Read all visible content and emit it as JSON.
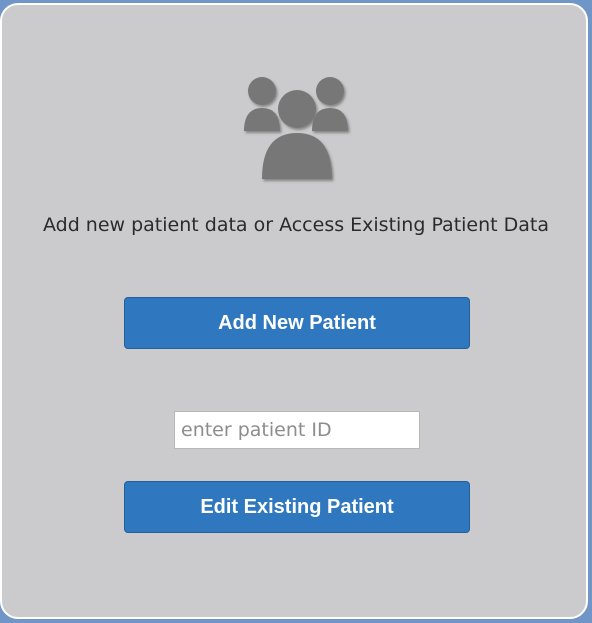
{
  "panel": {
    "icon": "users-group-icon",
    "prompt": "Add new patient data or Access Existing Patient Data"
  },
  "add_button": {
    "label": "Add New Patient"
  },
  "patient_id_input": {
    "value": "",
    "placeholder": "enter patient ID"
  },
  "edit_button": {
    "label": "Edit Existing Patient"
  },
  "colors": {
    "background": "#6f96c6",
    "panel": "#cbcbcd",
    "button": "#2f78bf",
    "icon": "#777777"
  }
}
